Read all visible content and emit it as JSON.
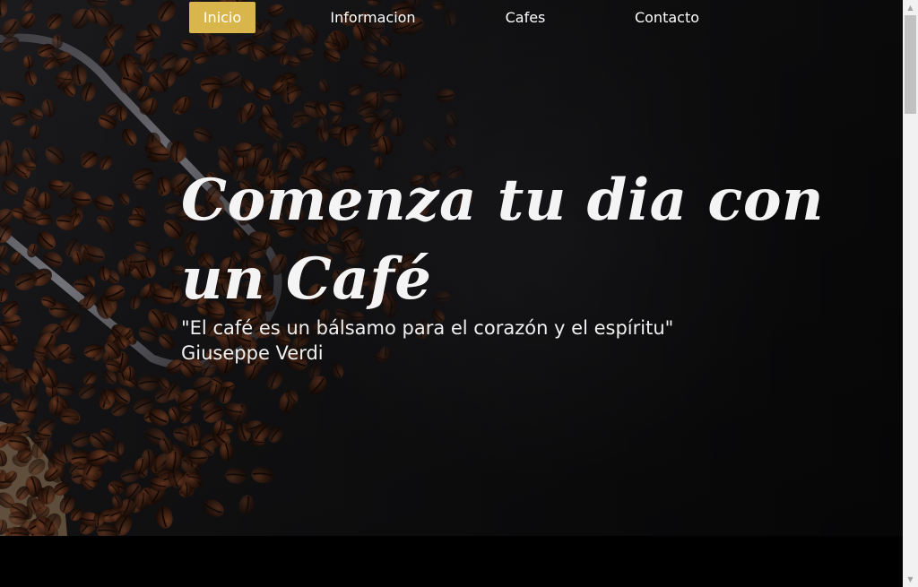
{
  "nav": {
    "items": [
      {
        "label": "Inicio",
        "active": true
      },
      {
        "label": "Informacion",
        "active": false
      },
      {
        "label": "Cafes",
        "active": false
      },
      {
        "label": "Contacto",
        "active": false
      }
    ]
  },
  "hero": {
    "headline": "Comenza tu dia con un Café",
    "quote": "\"El café es un bálsamo para el corazón y el espíritu\"",
    "author": "Giuseppe Verdi"
  },
  "colors": {
    "accent": "#d8b64b",
    "background": "#141416",
    "text": "#ffffff"
  },
  "icons": {
    "scroll_up": "triangle-up-icon",
    "scroll_down": "triangle-down-icon"
  }
}
